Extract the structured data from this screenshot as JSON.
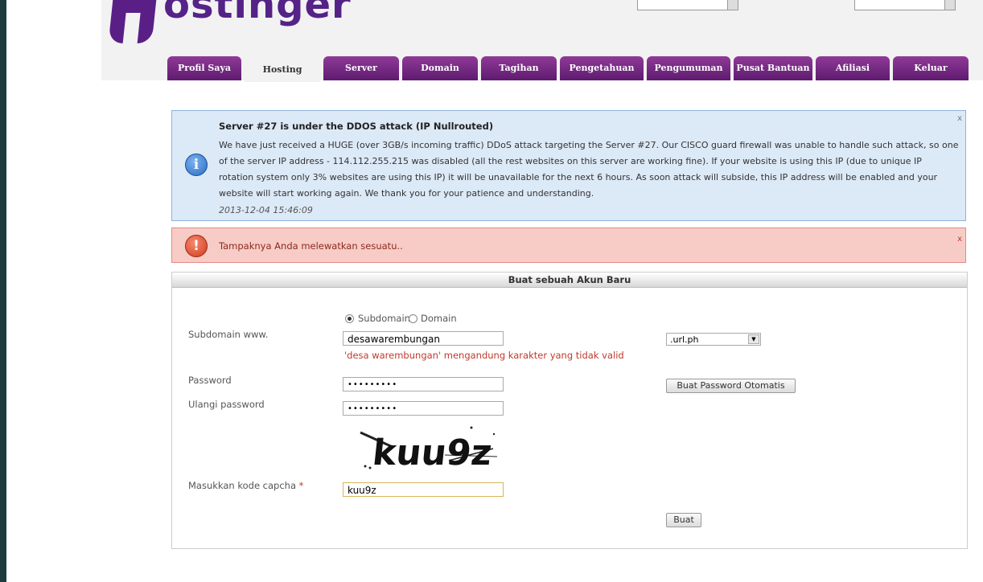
{
  "brand": {
    "logo_text": "ostinger"
  },
  "nav": {
    "tabs": [
      {
        "label": "Profil Saya"
      },
      {
        "label": "Hosting"
      },
      {
        "label": "Server"
      },
      {
        "label": "Domain"
      },
      {
        "label": "Tagihan"
      },
      {
        "label": "Pengetahuan"
      },
      {
        "label": "Pengumuman"
      },
      {
        "label": "Pusat Bantuan"
      },
      {
        "label": "Afiliasi"
      },
      {
        "label": "Keluar"
      }
    ],
    "active": "Hosting"
  },
  "info_alert": {
    "title": "Server #27 is under the DDOS attack (IP Nullrouted)",
    "body": "We have just received a HUGE (over 3GB/s incoming traffic) DDoS attack targeting the Server #27. Our CISCO guard firewall was unable to handle such attack, so one of the server IP address - 114.112.255.215 was disabled (all the rest websites on this server are working fine). If your website is using this IP (due to unique IP rotation system only 3% websites are using this IP) it will be unavailable for the next 6 hours. As soon attack will subside, this IP address will be enabled and your website will start working again. We thank you for your patience and understanding.",
    "date": "2013-12-04 15:46:09",
    "close": "x",
    "icon": "info-icon"
  },
  "error_alert": {
    "message": "Tampaknya Anda melewatkan sesuatu..",
    "close": "x",
    "icon": "error-icon"
  },
  "form": {
    "title": "Buat sebuah Akun Baru",
    "radio_subdomain": "Subdomain",
    "radio_domain": "Domain",
    "subdomain_label": "Subdomain www.",
    "subdomain_value": "desawarembungan",
    "subdomain_error": "'desa warembungan' mengandung karakter yang tidak valid",
    "suffix_value": ".url.ph",
    "password_label": "Password",
    "password_value": "•••••••••",
    "repeat_password_label": "Ulangi password",
    "repeat_password_value": "•••••••••",
    "auto_password_button": "Buat Password Otomatis",
    "captcha_text": "kuu9z",
    "captcha_label": "Masukkan kode capcha",
    "required_mark": "*",
    "captcha_value": "kuu9z",
    "submit_button": "Buat"
  },
  "colors": {
    "nav_tab": "#6e2582",
    "info_bg": "#dce9f7",
    "error_bg": "#f8ccc6",
    "error_text": "#c0392b"
  }
}
